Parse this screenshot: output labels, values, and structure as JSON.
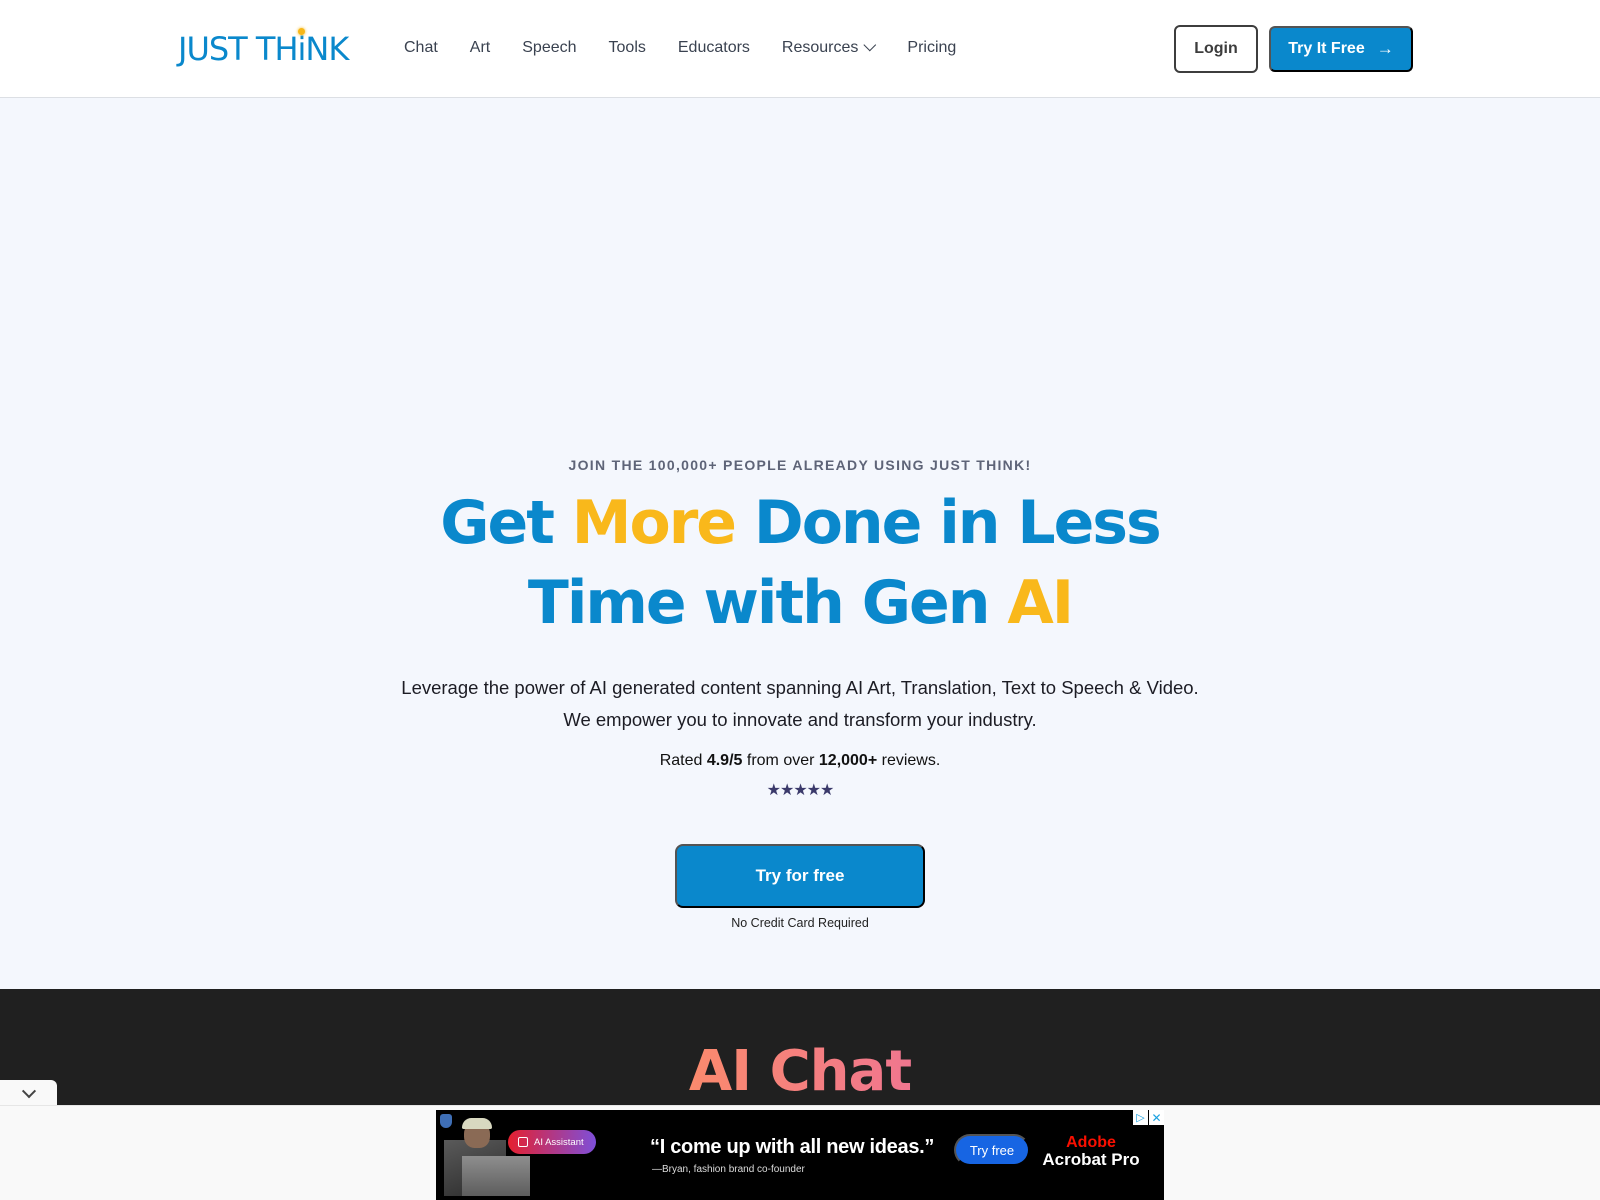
{
  "header": {
    "logo": {
      "part1": "JUST TH",
      "i": "i",
      "part2": "NK"
    },
    "nav": [
      {
        "label": "Chat"
      },
      {
        "label": "Art"
      },
      {
        "label": "Speech"
      },
      {
        "label": "Tools"
      },
      {
        "label": "Educators"
      },
      {
        "label": "Resources",
        "has_dropdown": true
      },
      {
        "label": "Pricing"
      }
    ],
    "login_label": "Login",
    "try_label": "Try It Free",
    "try_icon": "arrow-right-icon"
  },
  "hero": {
    "eyebrow": "JOIN THE 100,000+ PEOPLE ALREADY USING JUST THINK!",
    "headline": {
      "w1": "Get ",
      "w2_accent": "More",
      "w3": " Done in Less",
      "w4": "Time with Gen ",
      "w5_accent": "AI"
    },
    "lead": "Leverage the power of AI generated content spanning AI Art, Translation, Text to Speech & Video. We empower you to innovate and transform your industry.",
    "rating": {
      "prefix": "Rated ",
      "score": "4.9/5",
      "middle": " from over ",
      "count": "12,000+",
      "suffix": " reviews.",
      "stars": "★★★★★"
    },
    "cta_label": "Try for free",
    "cta_note": "No Credit Card Required"
  },
  "section": {
    "title": "AI Chat"
  },
  "ad": {
    "badge": "AI Assistant",
    "quote": "“I come up with all new ideas.”",
    "attribution": "—Bryan, fashion brand co-founder",
    "cta": "Try free",
    "brand_line1": "Adobe",
    "brand_line2": "Acrobat Pro",
    "info_glyph": "▷",
    "close_glyph": "✕"
  },
  "colors": {
    "brand_blue": "#0a88cc",
    "accent_yellow": "#f9b81b",
    "section_dark": "#202020",
    "section_title": "#f8847a"
  }
}
